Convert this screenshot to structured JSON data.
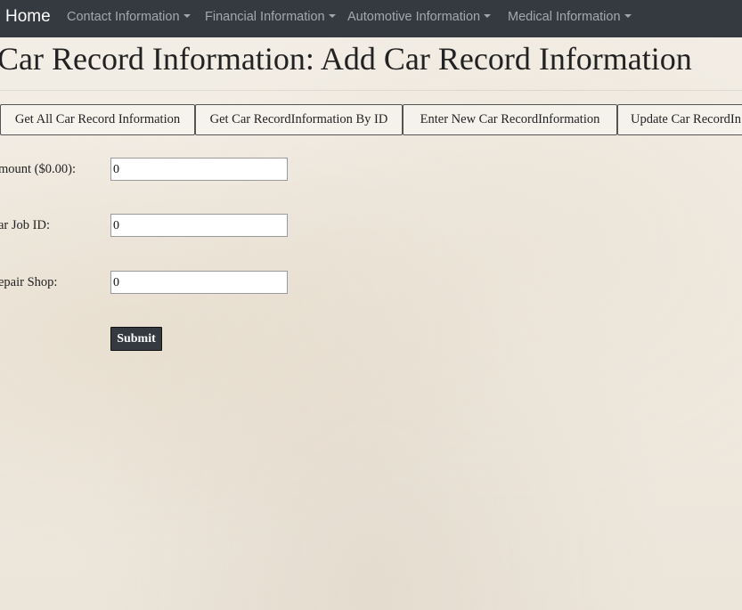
{
  "navbar": {
    "brand": "Home",
    "items": [
      {
        "label": "Contact Information"
      },
      {
        "label": "Financial Information"
      },
      {
        "label": "Automotive Information"
      },
      {
        "label": "Medical Information"
      }
    ]
  },
  "page": {
    "title": "Car Record Information: Add Car Record Information"
  },
  "tabs": [
    {
      "label": "Get All Car Record Information"
    },
    {
      "label": "Get Car RecordInformation By ID"
    },
    {
      "label": "Enter New Car RecordInformation"
    },
    {
      "label": "Update Car RecordIn"
    }
  ],
  "form": {
    "fields": [
      {
        "label": "mount ($0.00):",
        "value": "0"
      },
      {
        "label": "ar Job ID:",
        "value": "0"
      },
      {
        "label": "epair Shop:",
        "value": "0"
      }
    ],
    "submit_label": "Submit"
  },
  "colors": {
    "navbar_bg": "#343a40",
    "button_bg": "#343a40"
  }
}
